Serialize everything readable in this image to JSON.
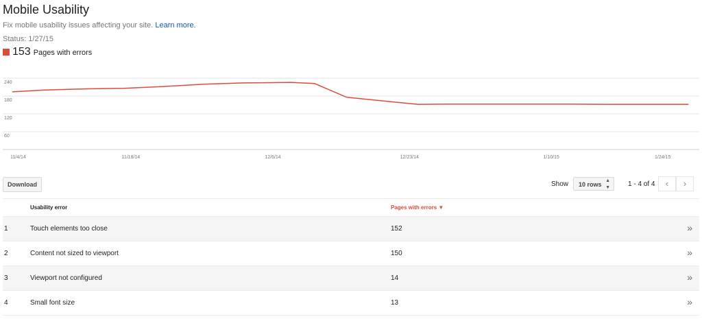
{
  "header": {
    "title": "Mobile Usability",
    "subtitle": "Fix mobile usability issues affecting your site.",
    "learn_more": "Learn more.",
    "status": "Status: 1/27/15",
    "metric_value": "153",
    "metric_label": "Pages with errors",
    "accent_color": "#dd4b39"
  },
  "chart_data": {
    "type": "line",
    "x_ticks": [
      "11/4/14",
      "11/18/14",
      "12/6/14",
      "12/23/14",
      "1/10/15",
      "1/24/15"
    ],
    "y_ticks": [
      240,
      180,
      120,
      60
    ],
    "ylim": [
      0,
      240
    ],
    "grid": true,
    "series": [
      {
        "color": "#dd4b39",
        "x": [
          "11/4/14",
          "11/8/14",
          "11/13/14",
          "11/18/14",
          "11/23/14",
          "11/28/14",
          "12/3/14",
          "12/9/14",
          "12/12/14",
          "12/16/14",
          "12/22/14",
          "12/25/14",
          "12/29/14",
          "1/3/15",
          "1/8/15",
          "1/13/15",
          "1/18/15",
          "1/23/15",
          "1/28/15"
        ],
        "values": [
          194,
          200,
          204,
          206,
          212,
          220,
          224,
          226,
          222,
          176,
          160,
          152,
          153,
          153,
          153,
          153,
          152,
          152,
          152
        ]
      }
    ]
  },
  "toolbar": {
    "download_label": "Download",
    "show_label": "Show",
    "rows_value": "10 rows",
    "pager_text": "1 - 4 of 4",
    "prev_icon": "‹",
    "next_icon": "›"
  },
  "table": {
    "col_error": "Usability error",
    "col_pages": "Pages with errors",
    "sort_icon": "▼",
    "rows": [
      {
        "idx": "1",
        "name": "Touch elements too close",
        "count": "152"
      },
      {
        "idx": "2",
        "name": "Content not sized to viewport",
        "count": "150"
      },
      {
        "idx": "3",
        "name": "Viewport not configured",
        "count": "14"
      },
      {
        "idx": "4",
        "name": "Small font size",
        "count": "13"
      }
    ],
    "row_icon": "»"
  }
}
